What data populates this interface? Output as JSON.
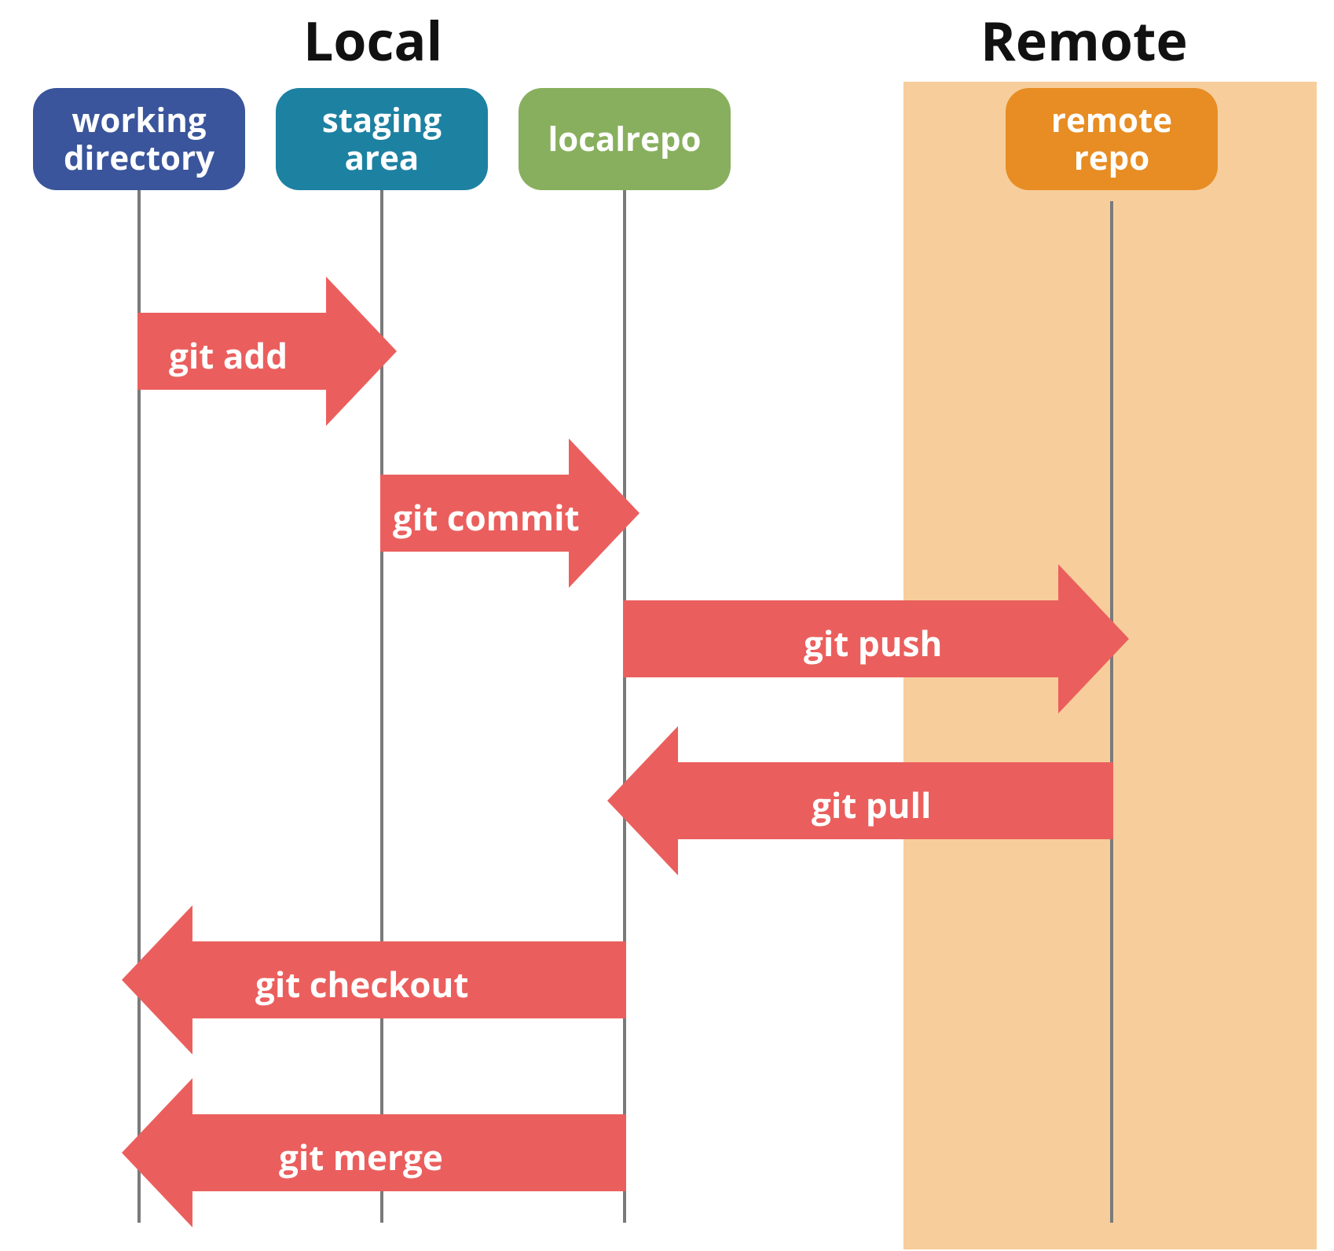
{
  "sections": {
    "local": "Local",
    "remote": "Remote"
  },
  "headers": {
    "working": "working\ndirectory",
    "staging": "staging\narea",
    "localrepo": "localrepo",
    "remoterepo": "remote\nrepo"
  },
  "arrows": {
    "add": "git add",
    "commit": "git commit",
    "push": "git push",
    "pull": "git pull",
    "checkout": "git checkout",
    "merge": "git merge"
  },
  "colors": {
    "working": "#3a559b",
    "staging": "#1d81a2",
    "localrepo": "#88af5e",
    "remoterepo": "#e78d23",
    "arrow": "#ea5f5d",
    "remoteBg": "#f7ce9b",
    "line": "#7a7a7a"
  }
}
